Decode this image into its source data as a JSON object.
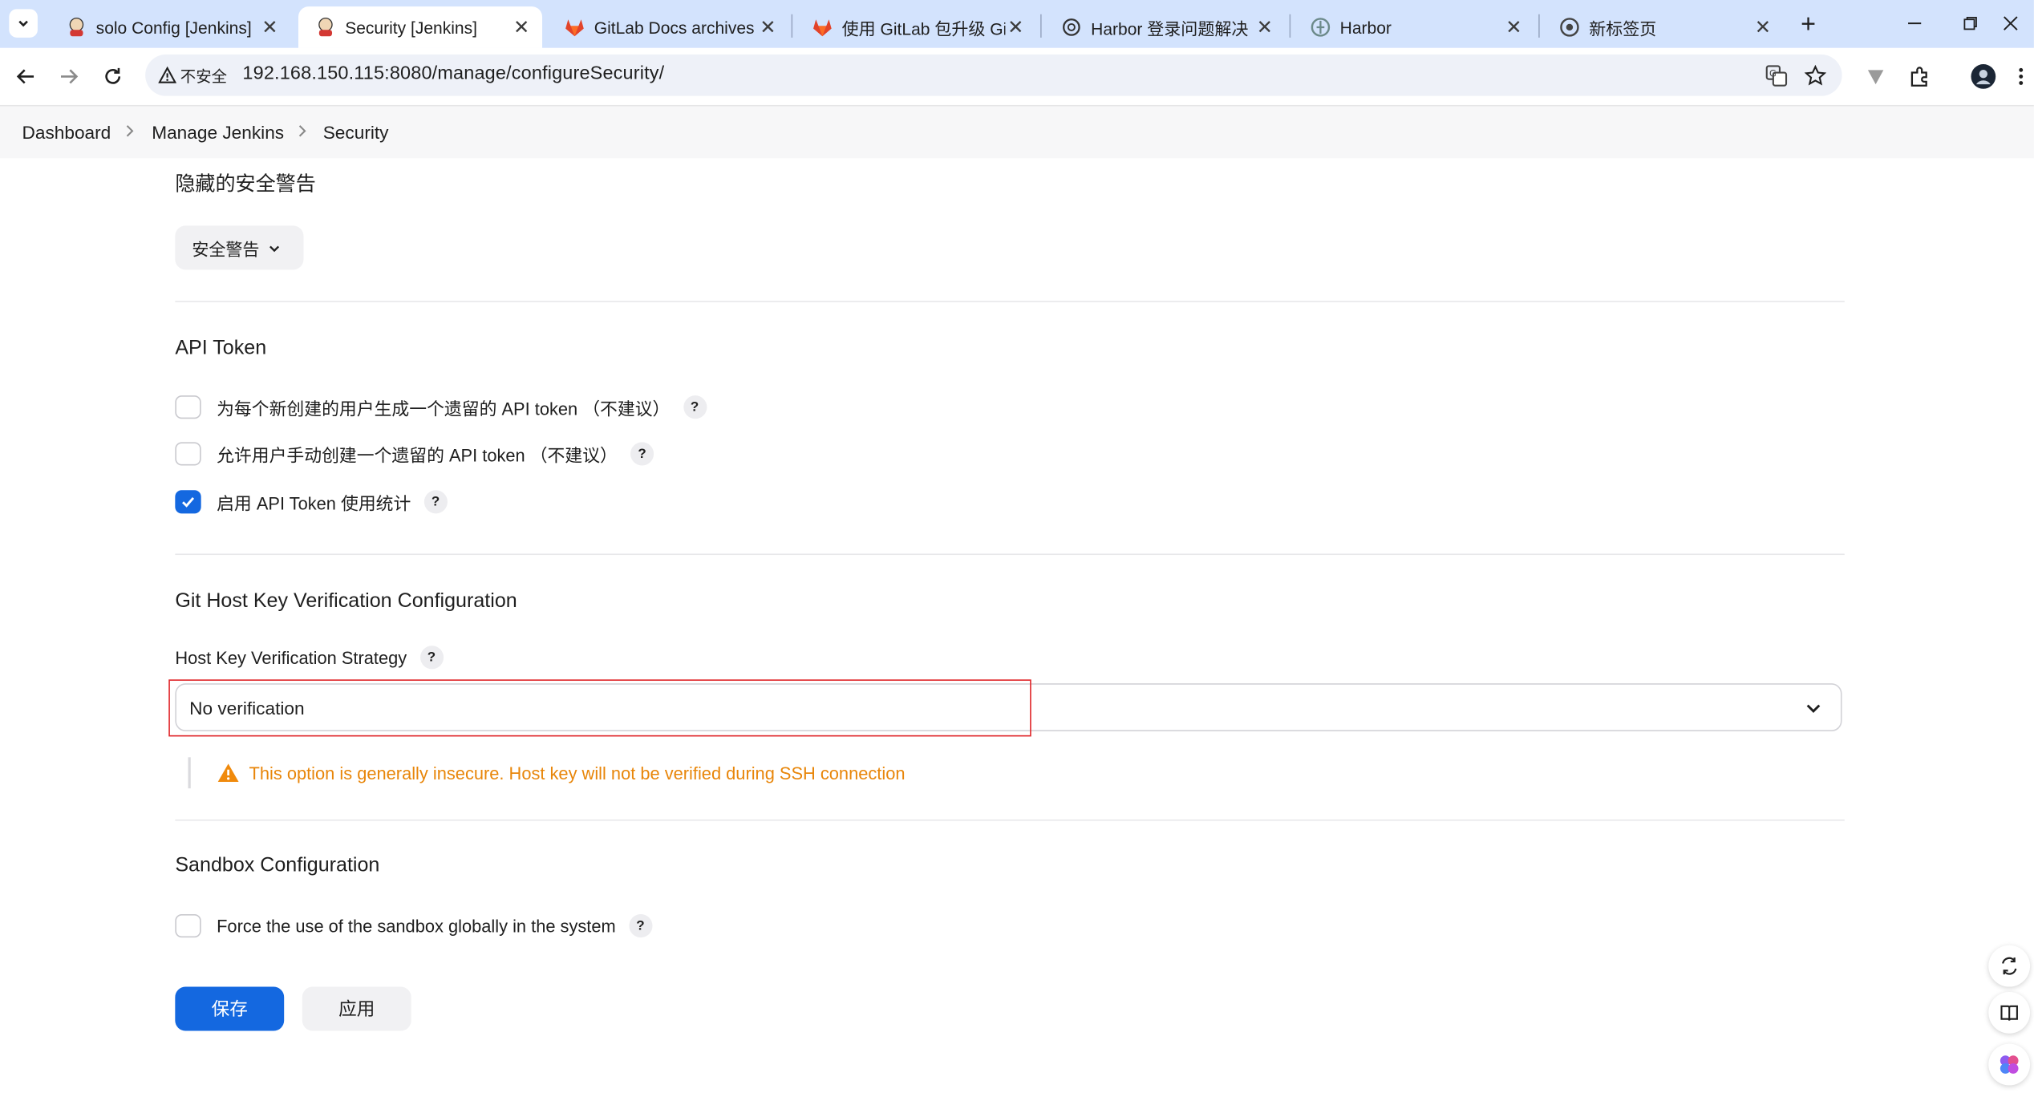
{
  "browser": {
    "tabs": [
      {
        "title": "solo Config [Jenkins]",
        "icon": "jenkins-icon",
        "active": false
      },
      {
        "title": "Security [Jenkins]",
        "icon": "jenkins-icon",
        "active": true
      },
      {
        "title": "GitLab Docs archives | G",
        "icon": "gitlab-icon",
        "active": false
      },
      {
        "title": "使用 GitLab 包升级 GitLa",
        "icon": "gitlab-icon",
        "active": false
      },
      {
        "title": "Harbor 登录问题解决",
        "icon": "chatgpt-icon",
        "active": false
      },
      {
        "title": "Harbor",
        "icon": "harbor-icon",
        "active": false
      },
      {
        "title": "新标签页",
        "icon": "chrome-icon",
        "active": false
      }
    ],
    "security_label": "不安全",
    "url": "192.168.150.115:8080/manage/configureSecurity/"
  },
  "breadcrumb": {
    "items": [
      "Dashboard",
      "Manage Jenkins",
      "Security"
    ]
  },
  "hidden_warnings": {
    "title": "隐藏的安全警告",
    "button_label": "安全警告"
  },
  "api_token": {
    "title": "API Token",
    "options": [
      {
        "label": "为每个新创建的用户生成一个遗留的 API token （不建议）",
        "checked": false
      },
      {
        "label": "允许用户手动创建一个遗留的 API token （不建议）",
        "checked": false
      },
      {
        "label": "启用 API Token 使用统计",
        "checked": true
      }
    ]
  },
  "git_host_key": {
    "title": "Git Host Key Verification Configuration",
    "strategy_label": "Host Key Verification Strategy",
    "selected_value": "No verification",
    "warning_text": "This option is generally insecure. Host key will not be verified during SSH connection"
  },
  "sandbox": {
    "title": "Sandbox Configuration",
    "option_label": "Force the use of the sandbox globally in the system",
    "checked": false
  },
  "actions": {
    "save_label": "保存",
    "apply_label": "应用"
  },
  "help_glyph": "?",
  "colors": {
    "primary": "#1468e0",
    "warning": "#e8860a",
    "highlight": "#e0262a",
    "tabstrip": "#d3e3fd"
  }
}
